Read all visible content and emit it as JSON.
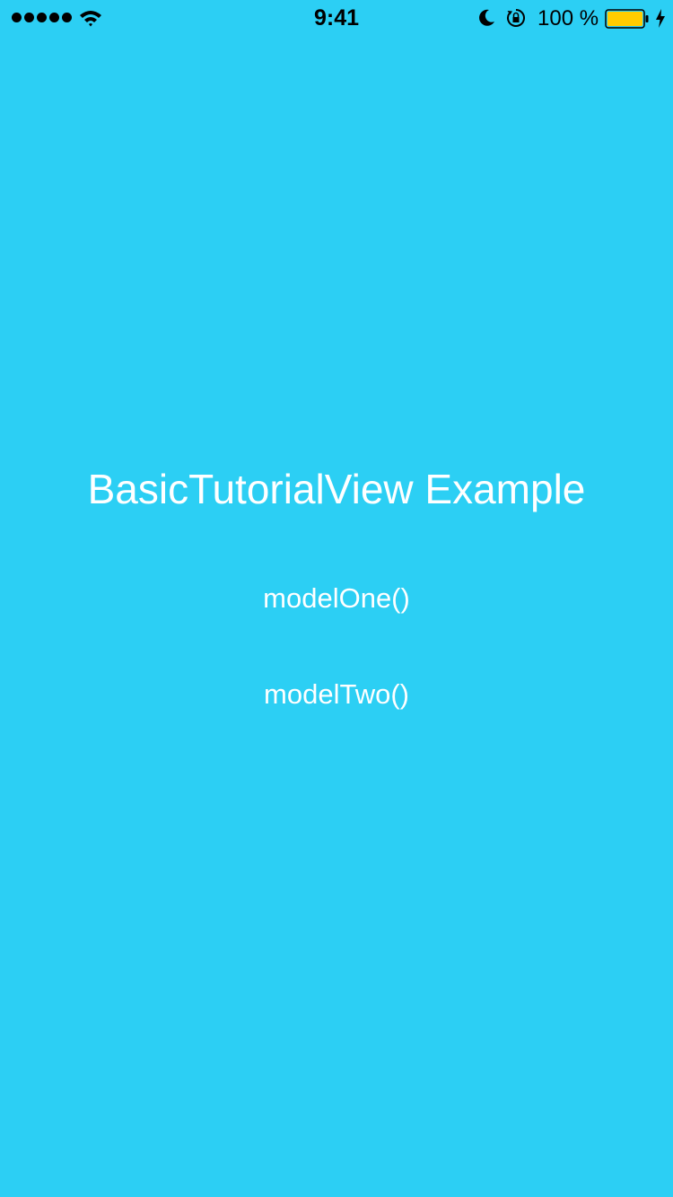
{
  "status_bar": {
    "time": "9:41",
    "battery_percent": "100 %",
    "signal_bars": 5,
    "battery_level": 1.0,
    "icons": [
      "signal-dots",
      "wifi-icon",
      "moon-icon",
      "rotation-lock-icon",
      "battery-icon",
      "charging-bolt-icon"
    ]
  },
  "main": {
    "title": "BasicTutorialView Example",
    "buttons": {
      "model_one": "modelOne()",
      "model_two": "modelTwo()"
    }
  },
  "colors": {
    "background": "#2ccff4",
    "text": "#ffffff",
    "battery_fill": "#ffcc00"
  }
}
